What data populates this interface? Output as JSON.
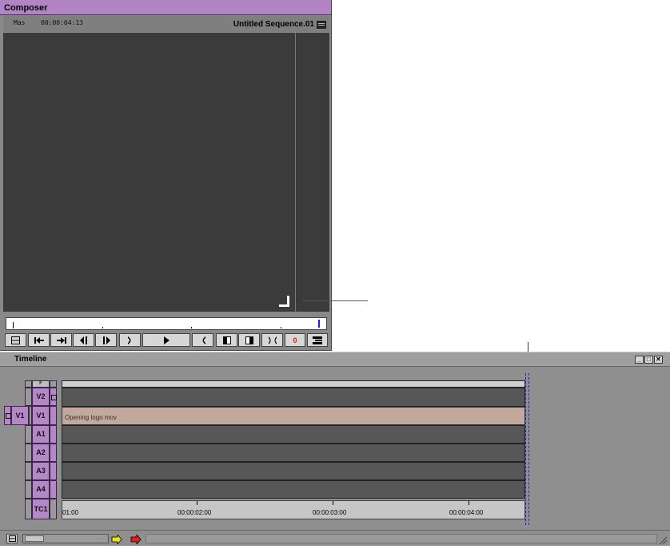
{
  "composer": {
    "title": "Composer",
    "source_label": "Mas",
    "timecode": "00:00:04:13",
    "sequence_name": "Untitled Sequence.01",
    "transport_buttons": [
      {
        "name": "toggle-source-record-button",
        "icon": "toggle-icon"
      },
      {
        "name": "go-to-previous-edit-button",
        "icon": "prev-edit-icon"
      },
      {
        "name": "go-to-next-edit-button",
        "icon": "next-edit-icon"
      },
      {
        "name": "step-backward-button",
        "icon": "step-back-icon"
      },
      {
        "name": "step-forward-button",
        "icon": "step-forward-icon"
      },
      {
        "name": "mark-out-button",
        "icon": "mark-out-icon"
      },
      {
        "name": "play-button",
        "icon": "play-icon"
      },
      {
        "name": "mark-in-button",
        "icon": "mark-in-icon"
      },
      {
        "name": "splice-in-button",
        "icon": "splice-icon"
      },
      {
        "name": "overwrite-button",
        "icon": "overwrite-icon"
      },
      {
        "name": "mark-clip-button",
        "icon": "mark-clip-icon"
      },
      {
        "name": "record-button",
        "label": "0"
      },
      {
        "name": "composer-fast-menu-button",
        "icon": "fast-menu-icon"
      }
    ]
  },
  "timeline": {
    "title": "Timeline",
    "window_buttons": [
      "_",
      "□",
      "✕"
    ],
    "header_label": "F",
    "tracks": [
      {
        "label": "V2",
        "type": "video"
      },
      {
        "label": "V1",
        "type": "video"
      },
      {
        "label": "A1",
        "type": "audio"
      },
      {
        "label": "A2",
        "type": "audio"
      },
      {
        "label": "A3",
        "type": "audio"
      },
      {
        "label": "A4",
        "type": "audio"
      },
      {
        "label": "TC1",
        "type": "timecode"
      }
    ],
    "source_track": "V1",
    "clip_name": "Opening logo mov",
    "timecodes": [
      "01:00",
      "00:00:02:00",
      "00:00:03:00",
      "00:00:04:00"
    ]
  },
  "colors": {
    "accent_purple": "#b488c7",
    "clip_color": "#c3a89c",
    "position_indicator": "#2222cc",
    "record_red": "#cc2200"
  }
}
